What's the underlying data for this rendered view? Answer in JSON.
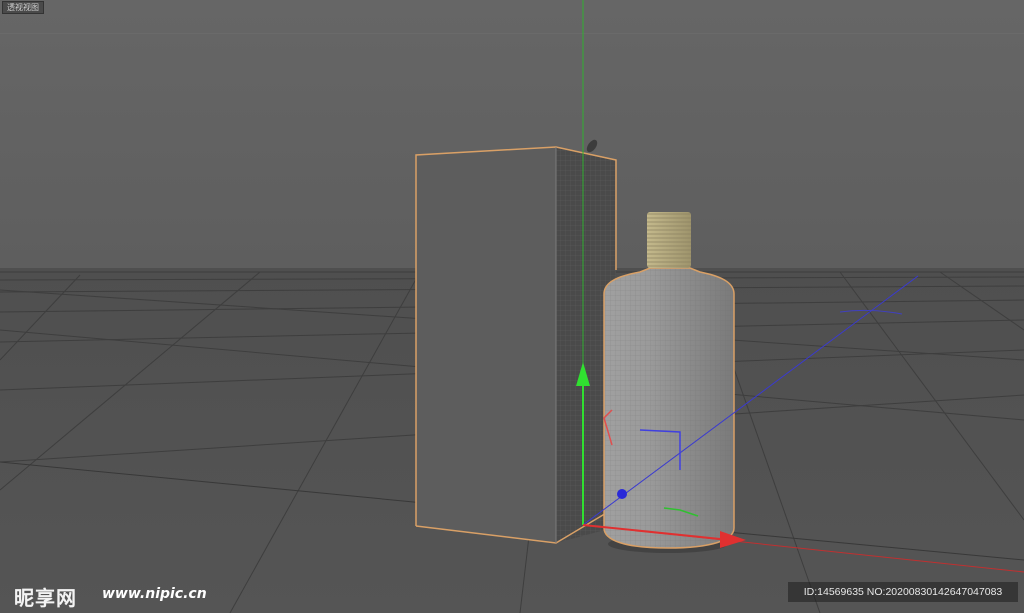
{
  "viewport": {
    "view_label": "透视视图"
  },
  "scene": {
    "objects": [
      "box",
      "bottle",
      "bottle-cap",
      "bottle-shadow"
    ],
    "selection_color": "#d9a066",
    "axis_colors": {
      "x": "#e03030",
      "y": "#30d030",
      "z": "#3030e0"
    }
  },
  "watermark": {
    "logo_text": "昵享网",
    "url": "www.nipic.cn",
    "id_text": "ID:14569635 NO:20200830142647047083"
  },
  "colors": {
    "background": "#5a5a5a",
    "floor_grid": "#404040",
    "bottle_body": "#8e8e8e",
    "cap": "#b8ad82"
  }
}
